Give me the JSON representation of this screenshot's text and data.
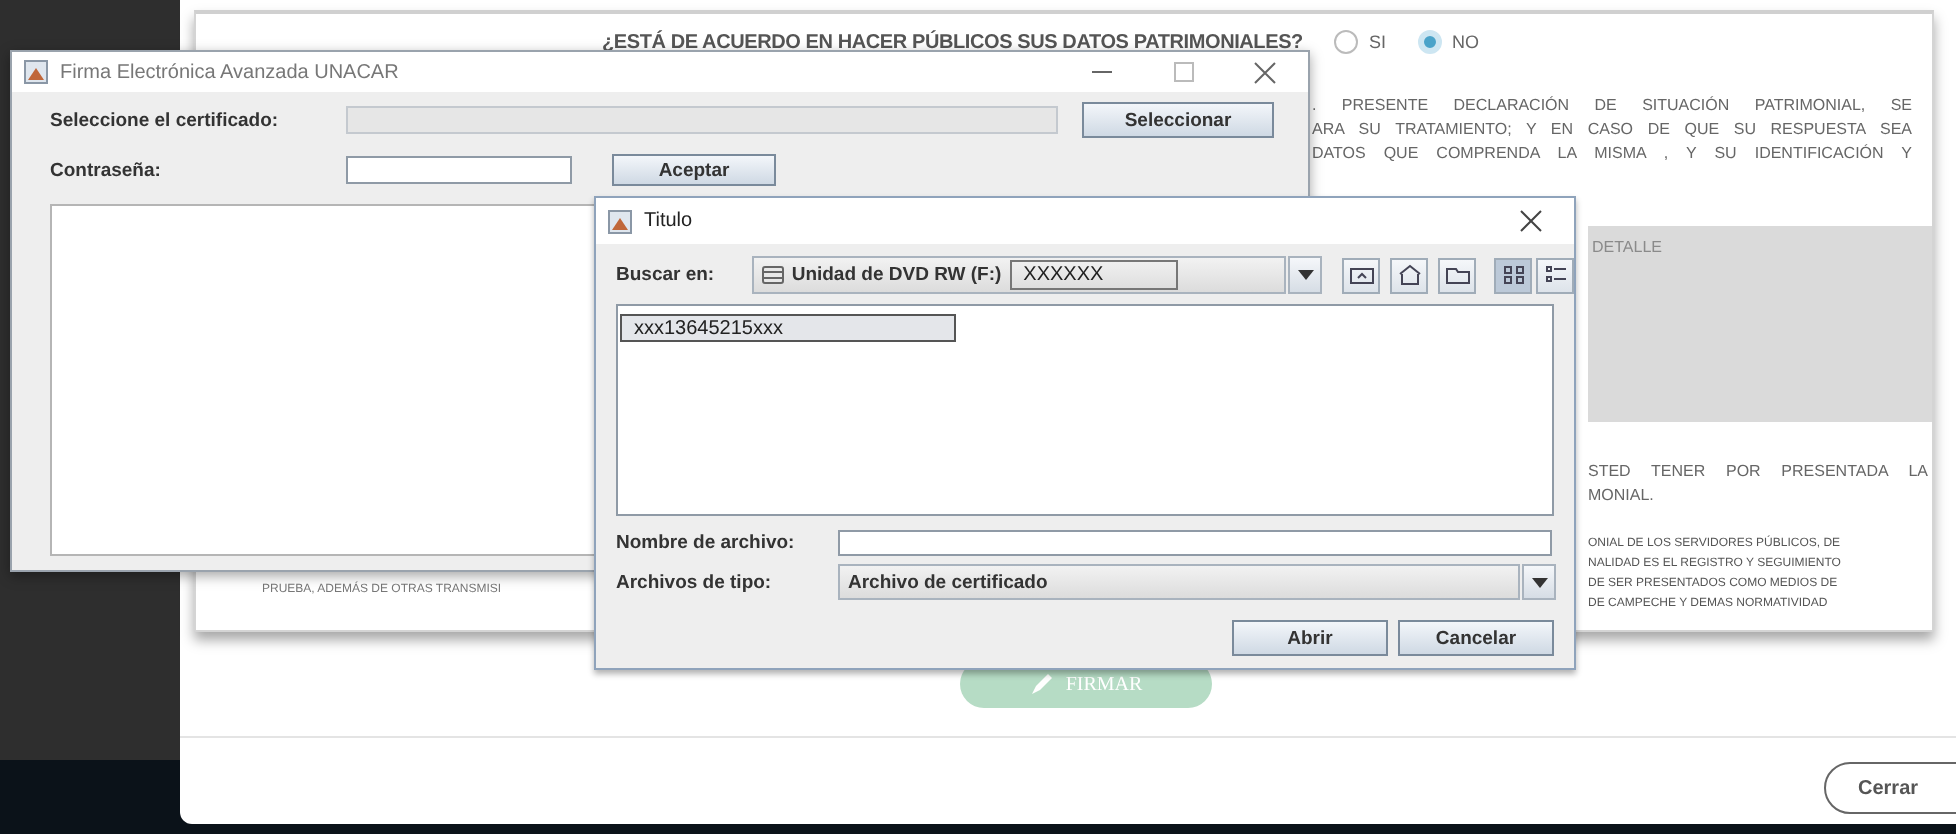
{
  "web_modal": {
    "question": "¿ESTÁ DE ACUERDO EN HACER PÚBLICOS SUS DATOS PATRIMONIALES?",
    "options": [
      {
        "label": "SI",
        "selected": false
      },
      {
        "label": "NO",
        "selected": true
      }
    ],
    "paragraph_lines": [
      ". PRESENTE DECLARACIÓN DE SITUACIÓN PATRIMONIAL, SE",
      "ARA SU TRATAMIENTO; Y EN CASO DE QUE SU RESPUESTA SEA",
      "DATOS QUE COMPRENDA LA MISMA , Y SU IDENTIFICACIÓN Y"
    ],
    "detail_label": "DETALLE",
    "confirm_lines": [
      "STED TENER POR PRESENTADA LA",
      "MONIAL."
    ],
    "legal_lines": [
      "ONIAL DE LOS SERVIDORES PÚBLICOS, DE",
      "NALIDAD ES EL REGISTRO Y SEGUIMIENTO",
      "DE SER PRESENTADOS COMO MEDIOS DE",
      "DE CAMPECHE Y DEMAS NORMATIVIDAD"
    ],
    "left_fragment": "PRUEBA, ADEMÁS DE OTRAS TRANSMISI",
    "sign_button": "FIRMAR",
    "close_button": "Cerrar"
  },
  "signer_window": {
    "title": "Firma Electrónica Avanzada UNACAR",
    "certificate_label": "Seleccione el certificado:",
    "select_button": "Seleccionar",
    "password_label": "Contraseña:",
    "accept_button": "Aceptar"
  },
  "file_dialog": {
    "title": "Titulo",
    "look_in_label": "Buscar en:",
    "look_in_value": "Unidad de DVD RW (F:)",
    "look_in_extra": "XXXXXX",
    "view_buttons": [
      {
        "kind": "grid",
        "selected": true
      },
      {
        "kind": "details",
        "selected": false
      }
    ],
    "files": [
      {
        "name": "xxx13645215xxx",
        "selected": true
      }
    ],
    "file_name_label": "Nombre de archivo:",
    "file_type_label": "Archivos de tipo:",
    "file_type_value": "Archivo de certificado",
    "buttons": [
      "Abrir",
      "Cancelar"
    ]
  }
}
